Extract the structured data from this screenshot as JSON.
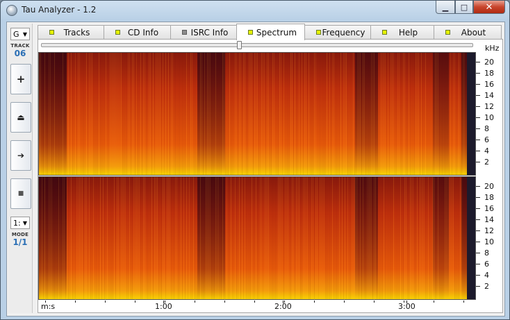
{
  "window": {
    "title": "Tau Analyzer - 1.2",
    "min_glyph": "▁",
    "max_glyph": "□",
    "close_glyph": "✕"
  },
  "leftbar": {
    "drive": "G",
    "drive_arrow": "▼",
    "track_caption": "TRACK",
    "track_value": "06",
    "buttons": [
      {
        "name": "add-button",
        "glyph": "+"
      },
      {
        "name": "eject-button",
        "glyph": "⏏"
      },
      {
        "name": "play-button",
        "glyph": "➔"
      },
      {
        "name": "stop-button",
        "glyph": "■"
      }
    ],
    "ratio_select": "1:",
    "mode_caption": "MODE",
    "mode_value": "1/1"
  },
  "tabs": [
    {
      "label": "Tracks",
      "led": "green",
      "active": false
    },
    {
      "label": "CD Info",
      "led": "green",
      "active": false
    },
    {
      "label": "ISRC Info",
      "led": "grey",
      "active": false
    },
    {
      "label": "Spectrum",
      "led": "green",
      "active": true
    },
    {
      "label": "Frequency",
      "led": "green",
      "active": false
    },
    {
      "label": "Help",
      "led": "green",
      "active": false
    },
    {
      "label": "About",
      "led": "green",
      "active": false
    }
  ],
  "spectrum": {
    "unit": "kHz",
    "y_labels": [
      "20",
      "18",
      "16",
      "14",
      "12",
      "10",
      "8",
      "6",
      "4",
      "2"
    ],
    "x_prefix": "m:s",
    "x_labels": [
      "1:00",
      "2:00",
      "3:00"
    ],
    "position": 0.46,
    "colors": {
      "high": "#f7d400",
      "mid": "#e85a0a",
      "low": "#3a0610"
    }
  }
}
